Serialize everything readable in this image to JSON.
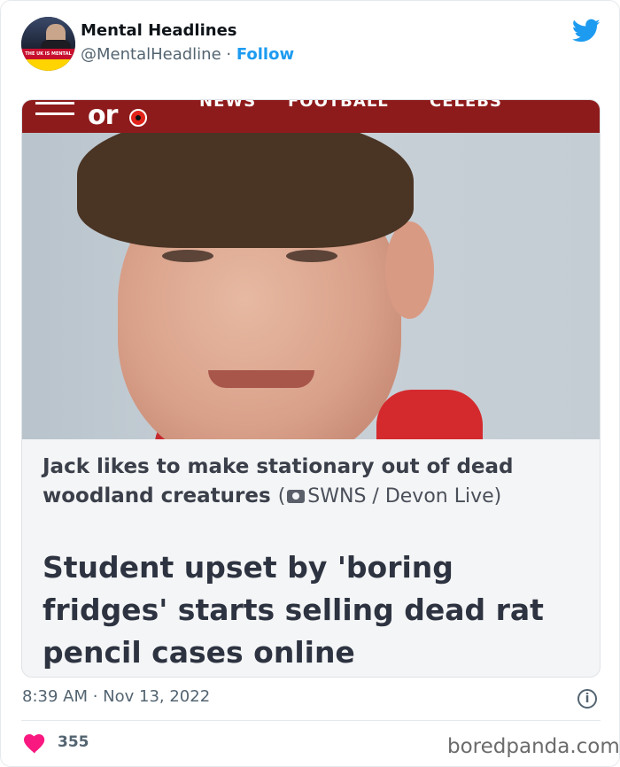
{
  "tweet": {
    "author": {
      "display_name": "Mental Headlines",
      "handle": "@MentalHeadline",
      "separator": " · ",
      "follow_label": "Follow",
      "avatar_banner_text": "THE UK IS MENTAL"
    },
    "embedded_article": {
      "site_logo_text": "or",
      "nav_items": [
        "NEWS",
        "FOOTBALL",
        "CELEBS"
      ],
      "caption": "Jack likes to make stationary out of dead woodland creatures",
      "credit": "SWNS / Devon Live",
      "headline": "Student upset by 'boring fridges' starts selling dead rat pencil cases online"
    },
    "timestamp": "8:39 AM · Nov 13, 2022",
    "likes": "355",
    "info_glyph": "i"
  },
  "watermark": "boredpanda.com",
  "colors": {
    "accent": "#1d9bf0",
    "site_bar": "#8e1b1b",
    "like": "#f91880",
    "secondary_text": "#536471"
  },
  "icons": {
    "brand": "twitter-bird-icon",
    "camera": "camera-icon",
    "info": "info-icon",
    "like": "heart-icon",
    "menu": "hamburger-menu-icon"
  }
}
